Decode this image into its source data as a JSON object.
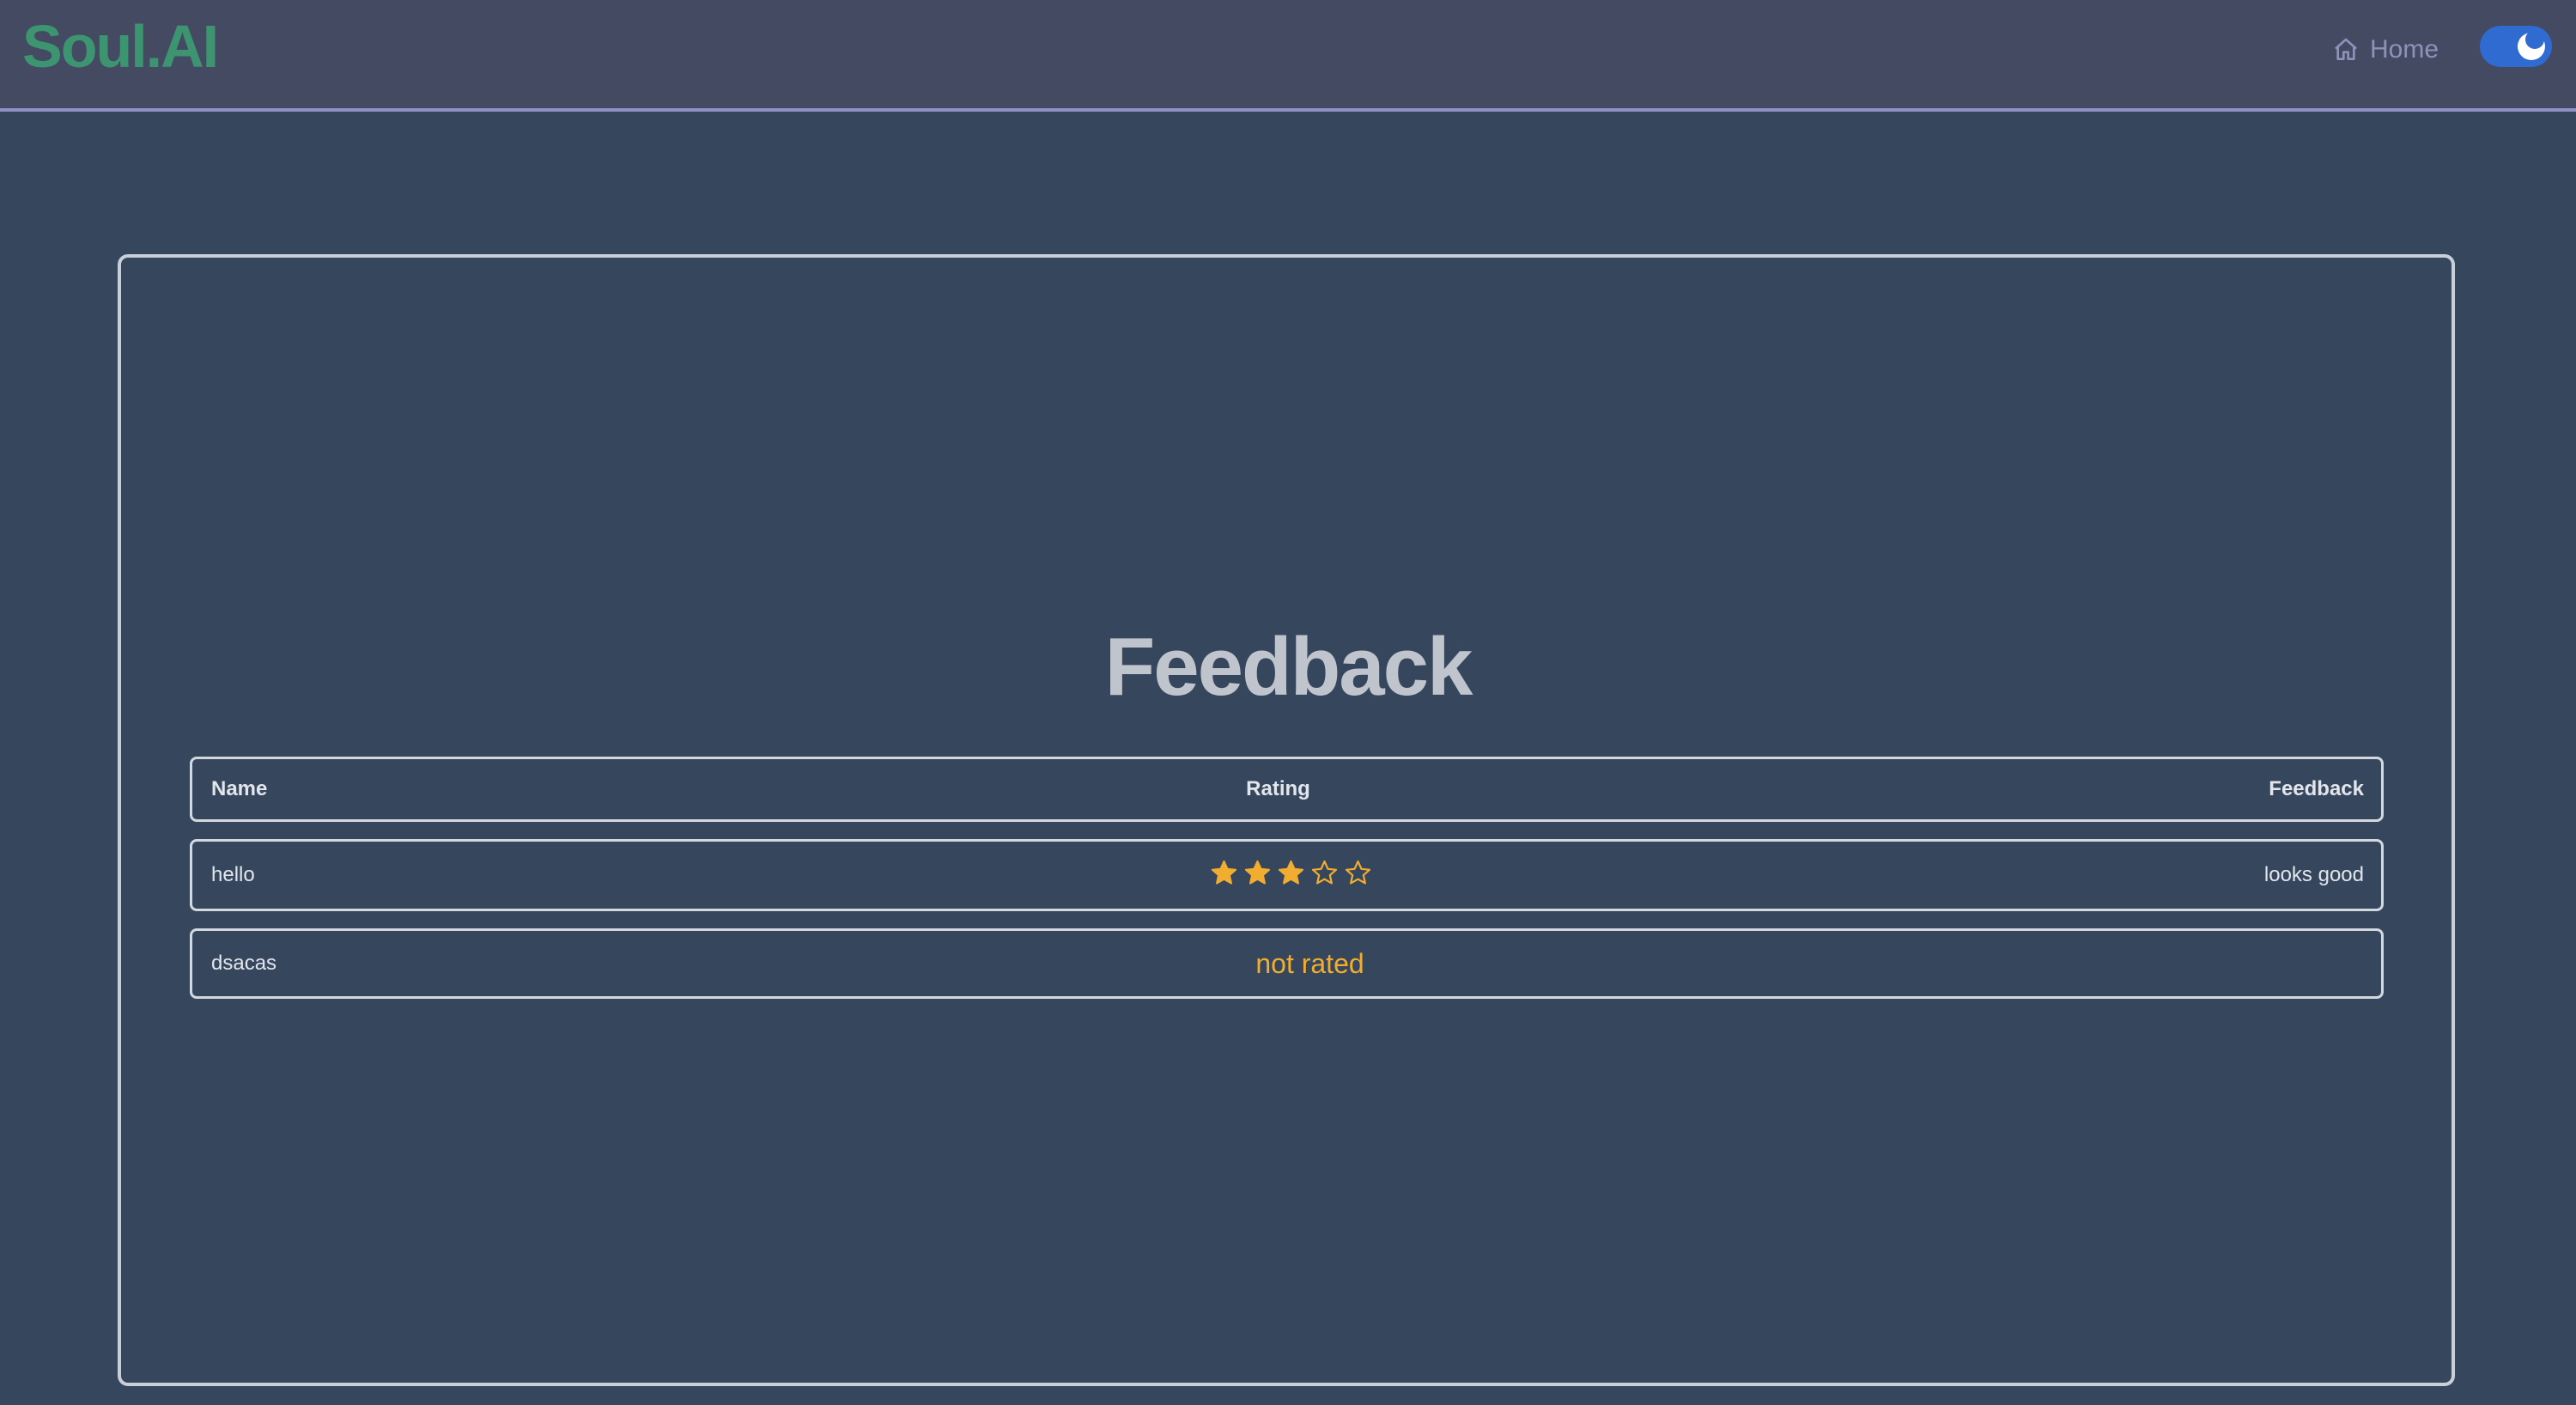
{
  "navbar": {
    "brand": "Soul.AI",
    "home_label": "Home"
  },
  "page": {
    "title": "Feedback"
  },
  "table": {
    "columns": [
      "Name",
      "Rating",
      "Feedback"
    ],
    "rows": [
      {
        "name": "hello",
        "rating": 3,
        "rating_max": 5,
        "rating_text": "",
        "feedback": "looks good"
      },
      {
        "name": "dsacas",
        "rating": null,
        "rating_text": "not rated",
        "feedback": ""
      }
    ]
  },
  "colors": {
    "accent_star": "#f0ad2f",
    "brand": "#3d9470",
    "toggle": "#2f6bd1"
  },
  "icons": {
    "home": "home-icon",
    "star_filled": "star-filled-icon",
    "star_empty": "star-empty-icon",
    "theme": "moon-toggle-icon"
  }
}
